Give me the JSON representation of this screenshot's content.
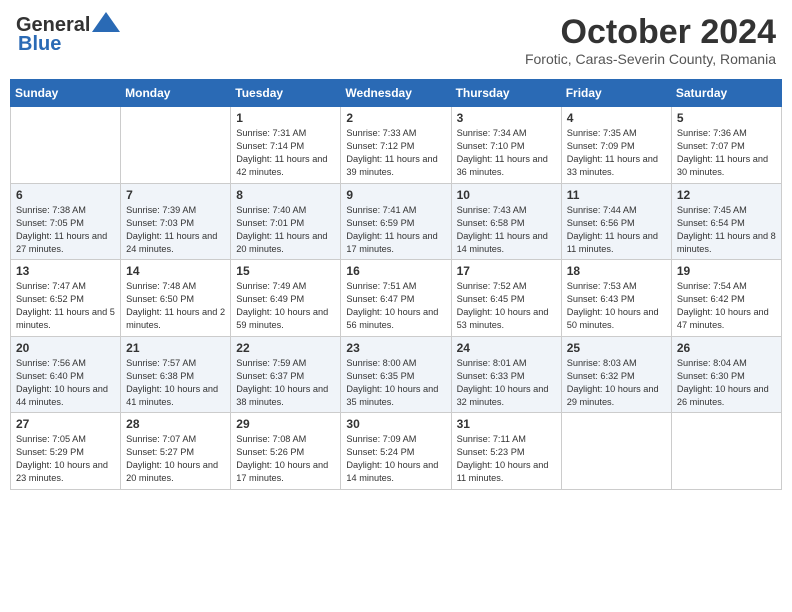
{
  "header": {
    "logo_line1": "General",
    "logo_line2": "Blue",
    "month": "October 2024",
    "location": "Forotic, Caras-Severin County, Romania"
  },
  "days_of_week": [
    "Sunday",
    "Monday",
    "Tuesday",
    "Wednesday",
    "Thursday",
    "Friday",
    "Saturday"
  ],
  "weeks": [
    [
      {
        "day": "",
        "sunrise": "",
        "sunset": "",
        "daylight": ""
      },
      {
        "day": "",
        "sunrise": "",
        "sunset": "",
        "daylight": ""
      },
      {
        "day": "1",
        "sunrise": "Sunrise: 7:31 AM",
        "sunset": "Sunset: 7:14 PM",
        "daylight": "Daylight: 11 hours and 42 minutes."
      },
      {
        "day": "2",
        "sunrise": "Sunrise: 7:33 AM",
        "sunset": "Sunset: 7:12 PM",
        "daylight": "Daylight: 11 hours and 39 minutes."
      },
      {
        "day": "3",
        "sunrise": "Sunrise: 7:34 AM",
        "sunset": "Sunset: 7:10 PM",
        "daylight": "Daylight: 11 hours and 36 minutes."
      },
      {
        "day": "4",
        "sunrise": "Sunrise: 7:35 AM",
        "sunset": "Sunset: 7:09 PM",
        "daylight": "Daylight: 11 hours and 33 minutes."
      },
      {
        "day": "5",
        "sunrise": "Sunrise: 7:36 AM",
        "sunset": "Sunset: 7:07 PM",
        "daylight": "Daylight: 11 hours and 30 minutes."
      }
    ],
    [
      {
        "day": "6",
        "sunrise": "Sunrise: 7:38 AM",
        "sunset": "Sunset: 7:05 PM",
        "daylight": "Daylight: 11 hours and 27 minutes."
      },
      {
        "day": "7",
        "sunrise": "Sunrise: 7:39 AM",
        "sunset": "Sunset: 7:03 PM",
        "daylight": "Daylight: 11 hours and 24 minutes."
      },
      {
        "day": "8",
        "sunrise": "Sunrise: 7:40 AM",
        "sunset": "Sunset: 7:01 PM",
        "daylight": "Daylight: 11 hours and 20 minutes."
      },
      {
        "day": "9",
        "sunrise": "Sunrise: 7:41 AM",
        "sunset": "Sunset: 6:59 PM",
        "daylight": "Daylight: 11 hours and 17 minutes."
      },
      {
        "day": "10",
        "sunrise": "Sunrise: 7:43 AM",
        "sunset": "Sunset: 6:58 PM",
        "daylight": "Daylight: 11 hours and 14 minutes."
      },
      {
        "day": "11",
        "sunrise": "Sunrise: 7:44 AM",
        "sunset": "Sunset: 6:56 PM",
        "daylight": "Daylight: 11 hours and 11 minutes."
      },
      {
        "day": "12",
        "sunrise": "Sunrise: 7:45 AM",
        "sunset": "Sunset: 6:54 PM",
        "daylight": "Daylight: 11 hours and 8 minutes."
      }
    ],
    [
      {
        "day": "13",
        "sunrise": "Sunrise: 7:47 AM",
        "sunset": "Sunset: 6:52 PM",
        "daylight": "Daylight: 11 hours and 5 minutes."
      },
      {
        "day": "14",
        "sunrise": "Sunrise: 7:48 AM",
        "sunset": "Sunset: 6:50 PM",
        "daylight": "Daylight: 11 hours and 2 minutes."
      },
      {
        "day": "15",
        "sunrise": "Sunrise: 7:49 AM",
        "sunset": "Sunset: 6:49 PM",
        "daylight": "Daylight: 10 hours and 59 minutes."
      },
      {
        "day": "16",
        "sunrise": "Sunrise: 7:51 AM",
        "sunset": "Sunset: 6:47 PM",
        "daylight": "Daylight: 10 hours and 56 minutes."
      },
      {
        "day": "17",
        "sunrise": "Sunrise: 7:52 AM",
        "sunset": "Sunset: 6:45 PM",
        "daylight": "Daylight: 10 hours and 53 minutes."
      },
      {
        "day": "18",
        "sunrise": "Sunrise: 7:53 AM",
        "sunset": "Sunset: 6:43 PM",
        "daylight": "Daylight: 10 hours and 50 minutes."
      },
      {
        "day": "19",
        "sunrise": "Sunrise: 7:54 AM",
        "sunset": "Sunset: 6:42 PM",
        "daylight": "Daylight: 10 hours and 47 minutes."
      }
    ],
    [
      {
        "day": "20",
        "sunrise": "Sunrise: 7:56 AM",
        "sunset": "Sunset: 6:40 PM",
        "daylight": "Daylight: 10 hours and 44 minutes."
      },
      {
        "day": "21",
        "sunrise": "Sunrise: 7:57 AM",
        "sunset": "Sunset: 6:38 PM",
        "daylight": "Daylight: 10 hours and 41 minutes."
      },
      {
        "day": "22",
        "sunrise": "Sunrise: 7:59 AM",
        "sunset": "Sunset: 6:37 PM",
        "daylight": "Daylight: 10 hours and 38 minutes."
      },
      {
        "day": "23",
        "sunrise": "Sunrise: 8:00 AM",
        "sunset": "Sunset: 6:35 PM",
        "daylight": "Daylight: 10 hours and 35 minutes."
      },
      {
        "day": "24",
        "sunrise": "Sunrise: 8:01 AM",
        "sunset": "Sunset: 6:33 PM",
        "daylight": "Daylight: 10 hours and 32 minutes."
      },
      {
        "day": "25",
        "sunrise": "Sunrise: 8:03 AM",
        "sunset": "Sunset: 6:32 PM",
        "daylight": "Daylight: 10 hours and 29 minutes."
      },
      {
        "day": "26",
        "sunrise": "Sunrise: 8:04 AM",
        "sunset": "Sunset: 6:30 PM",
        "daylight": "Daylight: 10 hours and 26 minutes."
      }
    ],
    [
      {
        "day": "27",
        "sunrise": "Sunrise: 7:05 AM",
        "sunset": "Sunset: 5:29 PM",
        "daylight": "Daylight: 10 hours and 23 minutes."
      },
      {
        "day": "28",
        "sunrise": "Sunrise: 7:07 AM",
        "sunset": "Sunset: 5:27 PM",
        "daylight": "Daylight: 10 hours and 20 minutes."
      },
      {
        "day": "29",
        "sunrise": "Sunrise: 7:08 AM",
        "sunset": "Sunset: 5:26 PM",
        "daylight": "Daylight: 10 hours and 17 minutes."
      },
      {
        "day": "30",
        "sunrise": "Sunrise: 7:09 AM",
        "sunset": "Sunset: 5:24 PM",
        "daylight": "Daylight: 10 hours and 14 minutes."
      },
      {
        "day": "31",
        "sunrise": "Sunrise: 7:11 AM",
        "sunset": "Sunset: 5:23 PM",
        "daylight": "Daylight: 10 hours and 11 minutes."
      },
      {
        "day": "",
        "sunrise": "",
        "sunset": "",
        "daylight": ""
      },
      {
        "day": "",
        "sunrise": "",
        "sunset": "",
        "daylight": ""
      }
    ]
  ]
}
